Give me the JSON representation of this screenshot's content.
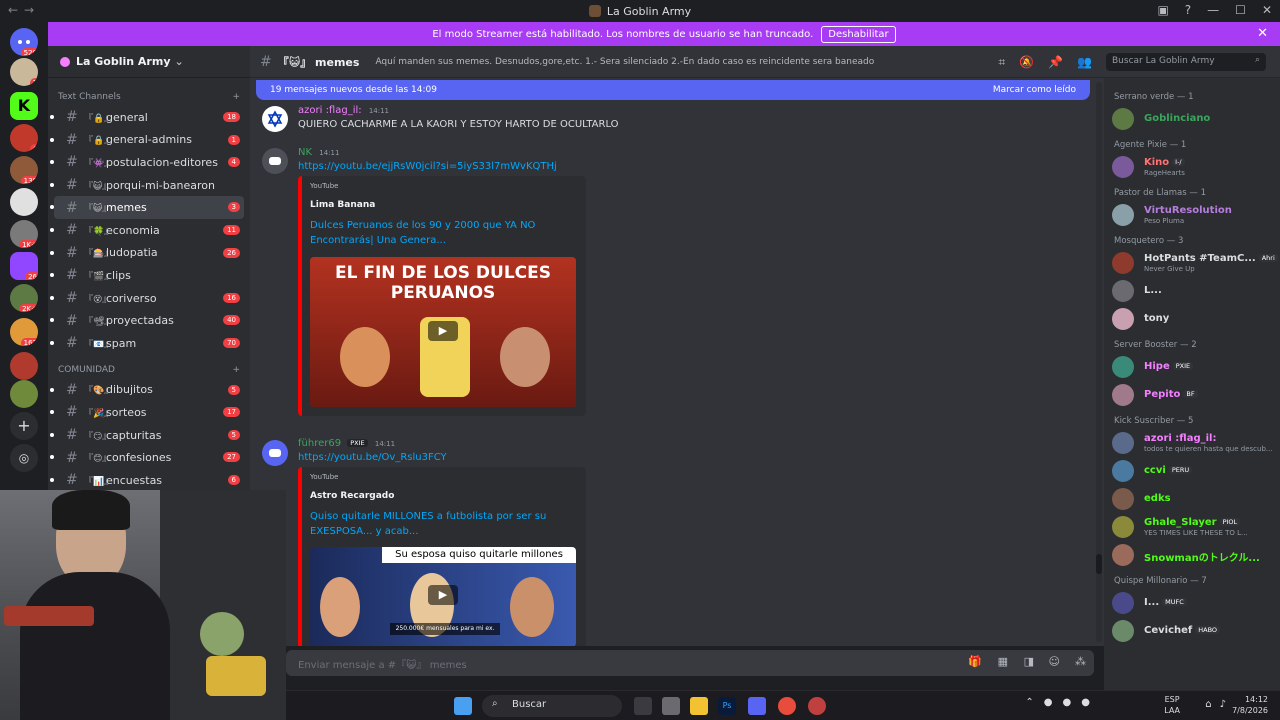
{
  "window": {
    "title": "La Goblin Army"
  },
  "banner": {
    "text": "El modo Streamer está habilitado. Los nombres de usuario se han truncado.",
    "button": "Deshabilitar"
  },
  "rail": {
    "badges": [
      "520",
      "1",
      "4",
      "138",
      "1K+",
      "26",
      "2K+",
      "162"
    ]
  },
  "server": {
    "name": "La Goblin Army"
  },
  "categories": {
    "text": "Text Channels",
    "community": "COMUNIDAD"
  },
  "channels": [
    {
      "prefix": "『🔒』",
      "name": "general",
      "count": "18"
    },
    {
      "prefix": "『🔒』",
      "name": "general-admins",
      "count": "1"
    },
    {
      "prefix": "『👾』",
      "name": "postulacion-editores",
      "count": "4"
    },
    {
      "prefix": "『😺』",
      "name": "porqui-mi-banearon",
      "count": ""
    },
    {
      "prefix": "『😺』",
      "name": "memes",
      "count": "3"
    },
    {
      "prefix": "『🍀』",
      "name": "economia",
      "count": "11"
    },
    {
      "prefix": "『🎰』",
      "name": "ludopatia",
      "count": "26"
    },
    {
      "prefix": "『🎬』",
      "name": "clips",
      "count": ""
    },
    {
      "prefix": "『😵』",
      "name": "coriverso",
      "count": "16"
    },
    {
      "prefix": "『📽』",
      "name": "proyectadas",
      "count": "40"
    },
    {
      "prefix": "『📧』",
      "name": "spam",
      "count": "70"
    }
  ],
  "community_channels": [
    {
      "prefix": "『🎨』",
      "name": "dibujitos",
      "count": "5"
    },
    {
      "prefix": "『🎉』",
      "name": "sorteos",
      "count": "17"
    },
    {
      "prefix": "『😏』",
      "name": "capturitas",
      "count": "5"
    },
    {
      "prefix": "『😊』",
      "name": "confesiones",
      "count": "27"
    },
    {
      "prefix": "『📊』",
      "name": "encuestas",
      "count": "6"
    }
  ],
  "header": {
    "channel": "『😺』 memes",
    "topic": "Aquí manden sus memes. Desnudos,gore,etc. 1.- Sera silenciado 2.-En dado caso es reincidente sera baneado",
    "search_placeholder": "Buscar La Goblin Army"
  },
  "new_messages": {
    "text": "19 mensajes nuevos desde las 14:09",
    "action": "Marcar como leído"
  },
  "messages": [
    {
      "user": "azori :flag_il:",
      "time": "14:11",
      "text": "QUIERO CACHARME A LA KAORI Y ESTOY HARTO DE OCULTARLO"
    },
    {
      "user": "NK",
      "time": "14:11",
      "link": "https://youtu.be/ejjRsW0jcil?si=5iyS33l7mWvKQTHj",
      "embed": {
        "provider": "YouTube",
        "author": "Lima Banana",
        "title": "Dulces Peruanos de los 90 y 2000 que YA NO Encontrarás| Una Genera...",
        "thumb_text": "EL FIN DE LOS DULCES PERUANOS"
      }
    },
    {
      "user": "führer69",
      "tag": "PXIE",
      "time": "14:11",
      "link": "https://youtu.be/Ov_Rslu3FCY",
      "embed": {
        "provider": "YouTube",
        "author": "Astro Recargado",
        "title": "Quiso quitarle MILLONES a futbolista por ser su EXESPOSA... y acab...",
        "thumb_text": "Su esposa quiso quitarle millones",
        "thumb_sub": "250.000€ mensuales para mi ex."
      }
    }
  ],
  "input": {
    "placeholder": "Enviar mensaje a #『😺』 memes"
  },
  "members": {
    "groups": [
      {
        "title": "Serrano verde — 1",
        "members": [
          {
            "name": "Goblinciano",
            "status": "",
            "tag": "",
            "color": "#3ba55d"
          }
        ]
      },
      {
        "title": "Agente Pixie — 1",
        "members": [
          {
            "name": "Kino",
            "status": "RageHearts",
            "tag": "I-/",
            "color": "#ff7373"
          }
        ]
      },
      {
        "title": "Pastor de Llamas — 1",
        "members": [
          {
            "name": "VirtuResolution",
            "status": "Peso Pluma",
            "tag": "",
            "color": "#b57edc"
          }
        ]
      },
      {
        "title": "Mosquetero — 3",
        "members": [
          {
            "name": "HotPants #TeamC...",
            "status": "Never Give Up",
            "tag": "Ahri",
            "color": "#dbdee1"
          },
          {
            "name": "L...",
            "status": "",
            "tag": "",
            "color": "#dbdee1"
          },
          {
            "name": "tony",
            "status": "",
            "tag": "",
            "color": "#dbdee1"
          }
        ]
      },
      {
        "title": "Server Booster — 2",
        "members": [
          {
            "name": "Hipe",
            "status": "",
            "tag": "PXIE",
            "color": "#f47fff"
          },
          {
            "name": "Pepito",
            "status": "",
            "tag": "BF",
            "color": "#f47fff"
          }
        ]
      },
      {
        "title": "Kick Suscriber — 5",
        "members": [
          {
            "name": "azori :flag_il:",
            "status": "todos te quieren hasta que descub...",
            "tag": "",
            "color": "#f47fff"
          },
          {
            "name": "ccvi",
            "status": "",
            "tag": "PERU",
            "color": "#53fc18"
          },
          {
            "name": "edks",
            "status": "",
            "tag": "",
            "color": "#53fc18"
          },
          {
            "name": "Ghale_Slayer",
            "status": "YES TIMES LIKE THESE TO L...",
            "tag": "PIOL",
            "color": "#53fc18"
          },
          {
            "name": "Snowmanのトレクル...",
            "status": "",
            "tag": "",
            "color": "#53fc18"
          }
        ]
      },
      {
        "title": "Quispe Millonario — 7",
        "members": [
          {
            "name": "I...",
            "status": "",
            "tag": "MUFC",
            "color": "#dbdee1"
          },
          {
            "name": "Cevichef",
            "status": "",
            "tag": "HABO",
            "color": "#dbdee1"
          }
        ]
      }
    ]
  },
  "taskbar": {
    "search": "Buscar",
    "lang1": "ESP",
    "lang2": "LAA",
    "time": "14:12",
    "date": "7/8/2026"
  }
}
